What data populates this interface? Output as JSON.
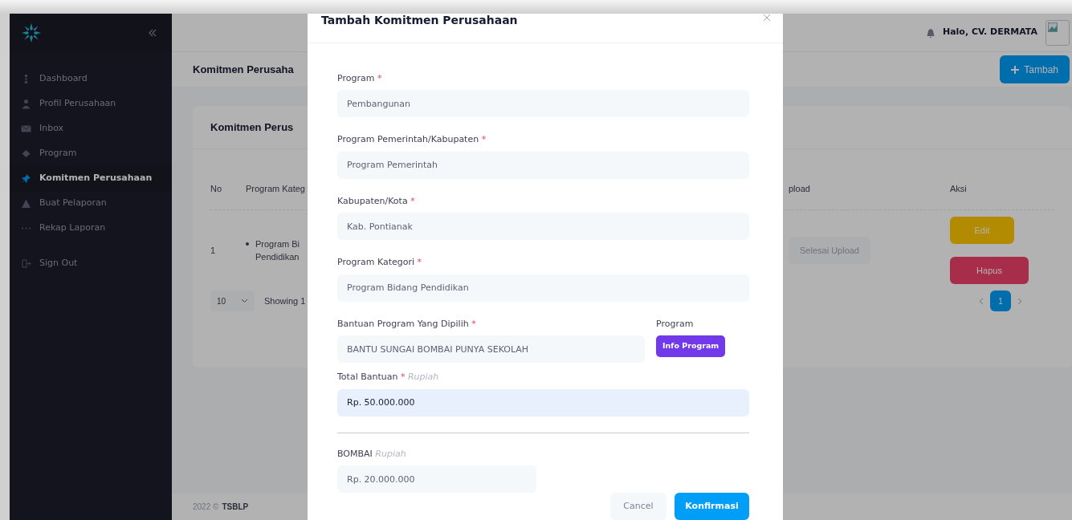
{
  "sidebar": {
    "items": [
      {
        "label": "Dashboard",
        "selected": false
      },
      {
        "label": "Profil Perusahaan",
        "selected": false
      },
      {
        "label": "Inbox",
        "selected": false
      },
      {
        "label": "Program",
        "selected": false
      },
      {
        "label": "Komitmen Perusahaan",
        "selected": true
      },
      {
        "label": "Buat Pelaporan",
        "selected": false
      },
      {
        "label": "Rekap Laporan",
        "selected": false
      }
    ],
    "sign_out": "Sign Out"
  },
  "topbar": {
    "greeting": "Halo, CV. DERMATA"
  },
  "page": {
    "title": "Komitmen Perusaha",
    "add_button": "Tambah"
  },
  "card": {
    "title": "Komitmen Perus",
    "columns": [
      "No",
      "Program Kateg",
      "pload",
      "Aksi"
    ],
    "rows": [
      {
        "no": "1",
        "category_lines": [
          "Program Bi",
          "Pendidikan"
        ],
        "status": "Selesai Upload",
        "actions": [
          {
            "label": "Edit",
            "kind": "edit"
          },
          {
            "label": "Hapus",
            "kind": "delete"
          }
        ]
      }
    ],
    "page_length": "10",
    "info": "Showing 1",
    "pages": [
      {
        "label": "1",
        "selected": true
      }
    ]
  },
  "footer": {
    "year": "2022 ©",
    "brand": "TSBLP"
  },
  "modal": {
    "title": "Tambah Komitmen Perusahaan",
    "fields": [
      {
        "label": "Program",
        "required_mark": "*",
        "value": "Pembangunan",
        "highlighted": false
      },
      {
        "label": "Program Pemerintah/Kabupaten",
        "required_mark": "*",
        "value": "Program Pemerintah",
        "highlighted": false
      },
      {
        "label": "Kabupaten/Kota",
        "required_mark": "*",
        "value": "Kab. Pontianak",
        "highlighted": false
      },
      {
        "label": "Program Kategori",
        "required_mark": "*",
        "value": "Program Bidang Pendidikan",
        "highlighted": false
      },
      {
        "label": "Bantuan Program Yang Dipilih",
        "required_mark": "*",
        "value": "BANTU SUNGAI BOMBAI PUNYA SEKOLAH",
        "highlighted": false,
        "side_label": "Program",
        "side_button": "Info Program"
      },
      {
        "label": "Total Bantuan",
        "required_mark": "*",
        "hint": "Rupiah",
        "value": "Rp. 50.000.000",
        "highlighted": true
      }
    ],
    "allocation": {
      "label": "BOMBAI",
      "hint": "Rupiah",
      "value": "Rp. 20.000.000"
    },
    "cancel": "Cancel",
    "confirm": "Konfirmasi"
  }
}
